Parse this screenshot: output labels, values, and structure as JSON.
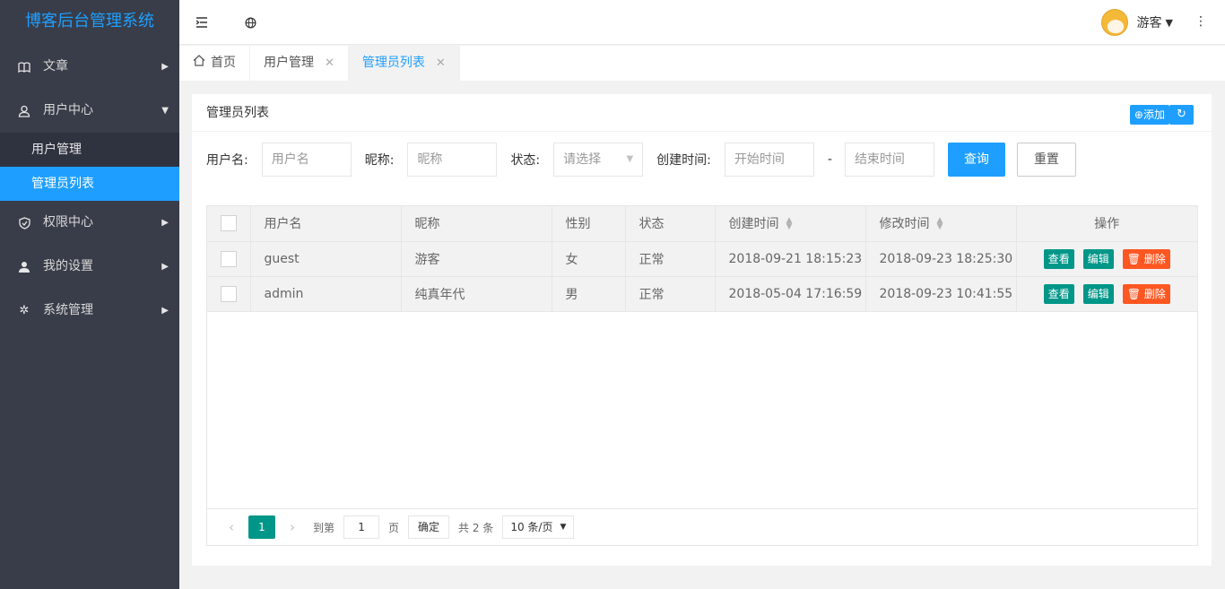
{
  "app": {
    "title": "博客后台管理系统"
  },
  "sidebar": {
    "items": [
      {
        "label": "文章",
        "icon": "book-icon"
      },
      {
        "label": "用户中心",
        "icon": "user-icon"
      },
      {
        "label": "权限中心",
        "icon": "shield-icon"
      },
      {
        "label": "我的设置",
        "icon": "person-icon"
      },
      {
        "label": "系统管理",
        "icon": "gear-icon"
      }
    ],
    "sub_items": [
      {
        "label": "用户管理"
      },
      {
        "label": "管理员列表"
      }
    ]
  },
  "header": {
    "user_name": "游客"
  },
  "tabs": [
    {
      "label": "首页"
    },
    {
      "label": "用户管理"
    },
    {
      "label": "管理员列表"
    }
  ],
  "card": {
    "title": "管理员列表",
    "add_label": "添加"
  },
  "filters": {
    "username_label": "用户名:",
    "username_placeholder": "用户名",
    "nickname_label": "昵称:",
    "nickname_placeholder": "昵称",
    "status_label": "状态:",
    "status_placeholder": "请选择",
    "created_label": "创建时间:",
    "start_placeholder": "开始时间",
    "dash": "-",
    "end_placeholder": "结束时间",
    "query_label": "查询",
    "reset_label": "重置"
  },
  "table": {
    "columns": [
      "用户名",
      "昵称",
      "性别",
      "状态",
      "创建时间",
      "修改时间",
      "操作"
    ],
    "rows": [
      {
        "username": "guest",
        "nickname": "游客",
        "gender": "女",
        "status": "正常",
        "created": "2018-09-21 18:15:23",
        "modified": "2018-09-23 18:25:30"
      },
      {
        "username": "admin",
        "nickname": "纯真年代",
        "gender": "男",
        "status": "正常",
        "created": "2018-05-04 17:16:59",
        "modified": "2018-09-23 10:41:55"
      }
    ],
    "actions": {
      "view": "查看",
      "edit": "编辑",
      "delete": "删除"
    }
  },
  "pager": {
    "current": "1",
    "goto_label": "到第",
    "goto_value": "1",
    "page_label": "页",
    "confirm_label": "确定",
    "total_label": "共 2 条",
    "per_page": "10 条/页"
  },
  "colors": {
    "accent": "#1e9fff",
    "sidebar": "#393d49",
    "green": "#009688",
    "danger": "#ff5722"
  }
}
